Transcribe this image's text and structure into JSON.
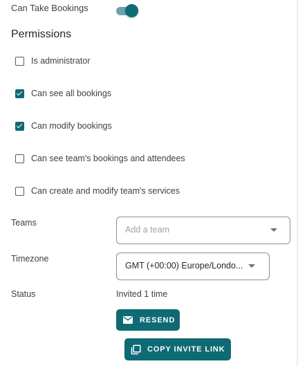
{
  "booking": {
    "label": "Can Take Bookings",
    "enabled": true
  },
  "permissions": {
    "title": "Permissions",
    "items": [
      {
        "label": "Is administrator",
        "checked": false
      },
      {
        "label": "Can see all bookings",
        "checked": true
      },
      {
        "label": "Can modify bookings",
        "checked": true
      },
      {
        "label": "Can see team's bookings and attendees",
        "checked": false
      },
      {
        "label": "Can create and modify team's services",
        "checked": false
      }
    ]
  },
  "teams": {
    "label": "Teams",
    "placeholder": "Add a team",
    "value": ""
  },
  "timezone": {
    "label": "Timezone",
    "value": "GMT (+00:00) Europe/Londo..."
  },
  "status": {
    "label": "Status",
    "value": "Invited 1 time",
    "resend_label": "RESEND",
    "copy_label": "COPY INVITE LINK"
  },
  "icons": {
    "resend": "mail-icon",
    "copy": "copy-icon",
    "dropdown": "chevron-down-icon"
  },
  "colors": {
    "accent": "#0e6a73",
    "toggle_track": "#6aa5aa"
  }
}
